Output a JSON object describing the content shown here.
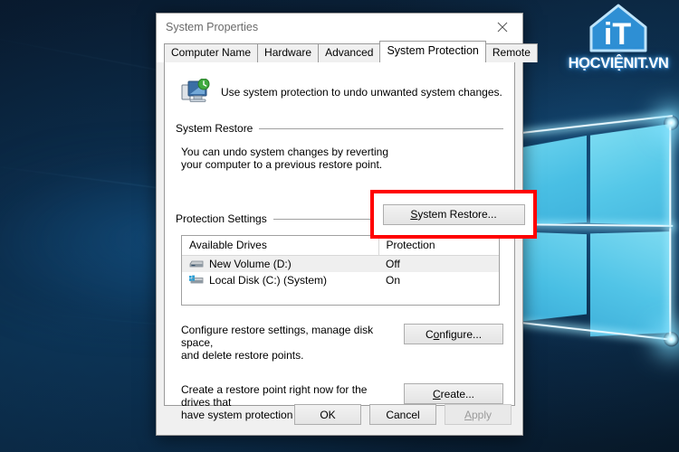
{
  "desktop": {
    "wallpaper_name": "windows-10-hero-wallpaper",
    "watermark_text": "HỌCVIỆNIT.VN",
    "watermark_logo_label": "iT",
    "colors": {
      "wallpaper_dark": "#0a1a2b",
      "logo_cyan": "#4cc3e6",
      "highlight_red": "#ff0000",
      "dialog_bg": "#f0f0f0"
    }
  },
  "dialog": {
    "title": "System Properties",
    "close_label": "✕",
    "tabs": [
      {
        "label": "Computer Name",
        "active": false
      },
      {
        "label": "Hardware",
        "active": false
      },
      {
        "label": "Advanced",
        "active": false
      },
      {
        "label": "System Protection",
        "active": true
      },
      {
        "label": "Remote",
        "active": false
      }
    ],
    "header": {
      "icon": "system-protection-icon",
      "text": "Use system protection to undo unwanted system changes."
    },
    "system_restore": {
      "group_title": "System Restore",
      "description_line1": "You can undo system changes by reverting",
      "description_line2": "your computer to a previous restore point.",
      "button_prefix": "S",
      "button_label": "ystem Restore...",
      "highlighted": true
    },
    "protection_settings": {
      "group_title": "Protection Settings",
      "columns": [
        "Available Drives",
        "Protection"
      ],
      "rows": [
        {
          "drive": "New Volume (D:)",
          "protection": "Off",
          "icon": "hard-drive-icon",
          "selected": true
        },
        {
          "drive": "Local Disk (C:) (System)",
          "protection": "On",
          "icon": "system-drive-icon",
          "selected": false
        }
      ],
      "configure": {
        "description_line1": "Configure restore settings, manage disk space,",
        "description_line2": "and delete restore points.",
        "button_prefix": "C",
        "button_mnemonic": "o",
        "button_label": "nfigure..."
      },
      "create": {
        "description_line1": "Create a restore point right now for the drives that",
        "description_line2": "have system protection turned on.",
        "button_prefix": "C",
        "button_label": "reate..."
      }
    },
    "footer": {
      "ok": "OK",
      "cancel": "Cancel",
      "apply_prefix": "A",
      "apply_label": "pply",
      "apply_disabled": true
    }
  }
}
